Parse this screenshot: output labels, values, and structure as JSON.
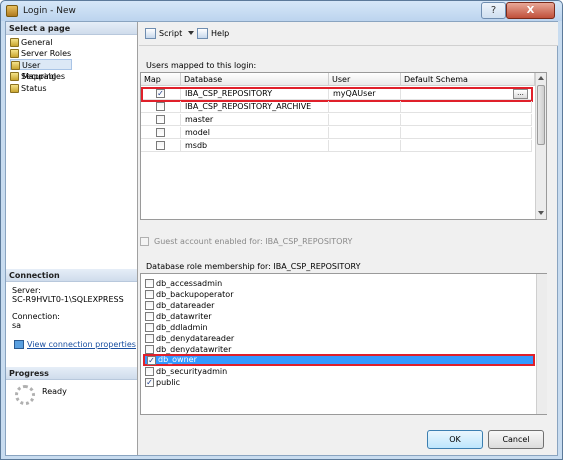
{
  "window": {
    "title": "Login - New",
    "help_icon": "?",
    "close_icon": "X"
  },
  "nav": {
    "header": "Select a page",
    "items": [
      {
        "label": "General",
        "icon": "page-icon"
      },
      {
        "label": "Server Roles",
        "icon": "page-icon"
      },
      {
        "label": "User Mapping",
        "icon": "page-icon",
        "selected": true
      },
      {
        "label": "Securables",
        "icon": "page-icon"
      },
      {
        "label": "Status",
        "icon": "page-icon"
      }
    ]
  },
  "connection": {
    "header": "Connection",
    "server_label": "Server:",
    "server_value": "SC-R9HVLT0-1\\SQLEXPRESS",
    "connection_label": "Connection:",
    "connection_value": "sa",
    "link": "View connection properties"
  },
  "progress": {
    "header": "Progress",
    "status": "Ready"
  },
  "toolbar": {
    "script_label": "Script",
    "help_label": "Help"
  },
  "users_mapped": {
    "label": "Users mapped to this login:",
    "columns": [
      "Map",
      "Database",
      "User",
      "Default Schema"
    ],
    "rows": [
      {
        "checked": true,
        "database": "IBA_CSP_REPOSITORY",
        "user": "myQAUser",
        "schema": "",
        "selected": true
      },
      {
        "checked": false,
        "database": "IBA_CSP_REPOSITORY_ARCHIVE",
        "user": "",
        "schema": ""
      },
      {
        "checked": false,
        "database": "master",
        "user": "",
        "schema": ""
      },
      {
        "checked": false,
        "database": "model",
        "user": "",
        "schema": ""
      },
      {
        "checked": false,
        "database": "msdb",
        "user": "",
        "schema": ""
      }
    ],
    "ellipsis": "..."
  },
  "guest_label": "Guest account enabled for: IBA_CSP_REPOSITORY",
  "role_label": "Database role membership for: IBA_CSP_REPOSITORY",
  "roles": [
    {
      "name": "db_accessadmin",
      "checked": false
    },
    {
      "name": "db_backupoperator",
      "checked": false
    },
    {
      "name": "db_datareader",
      "checked": false
    },
    {
      "name": "db_datawriter",
      "checked": false
    },
    {
      "name": "db_ddladmin",
      "checked": false
    },
    {
      "name": "db_denydatareader",
      "checked": false
    },
    {
      "name": "db_denydatawriter",
      "checked": false
    },
    {
      "name": "db_owner",
      "checked": true,
      "selected": true
    },
    {
      "name": "db_securityadmin",
      "checked": false
    },
    {
      "name": "public",
      "checked": true
    }
  ],
  "buttons": {
    "ok": "OK",
    "cancel": "Cancel"
  },
  "check_mark": "✓",
  "colors": {
    "selection": "#3399ff",
    "highlight_border": "#e0202a",
    "link": "#1a4fa0"
  }
}
